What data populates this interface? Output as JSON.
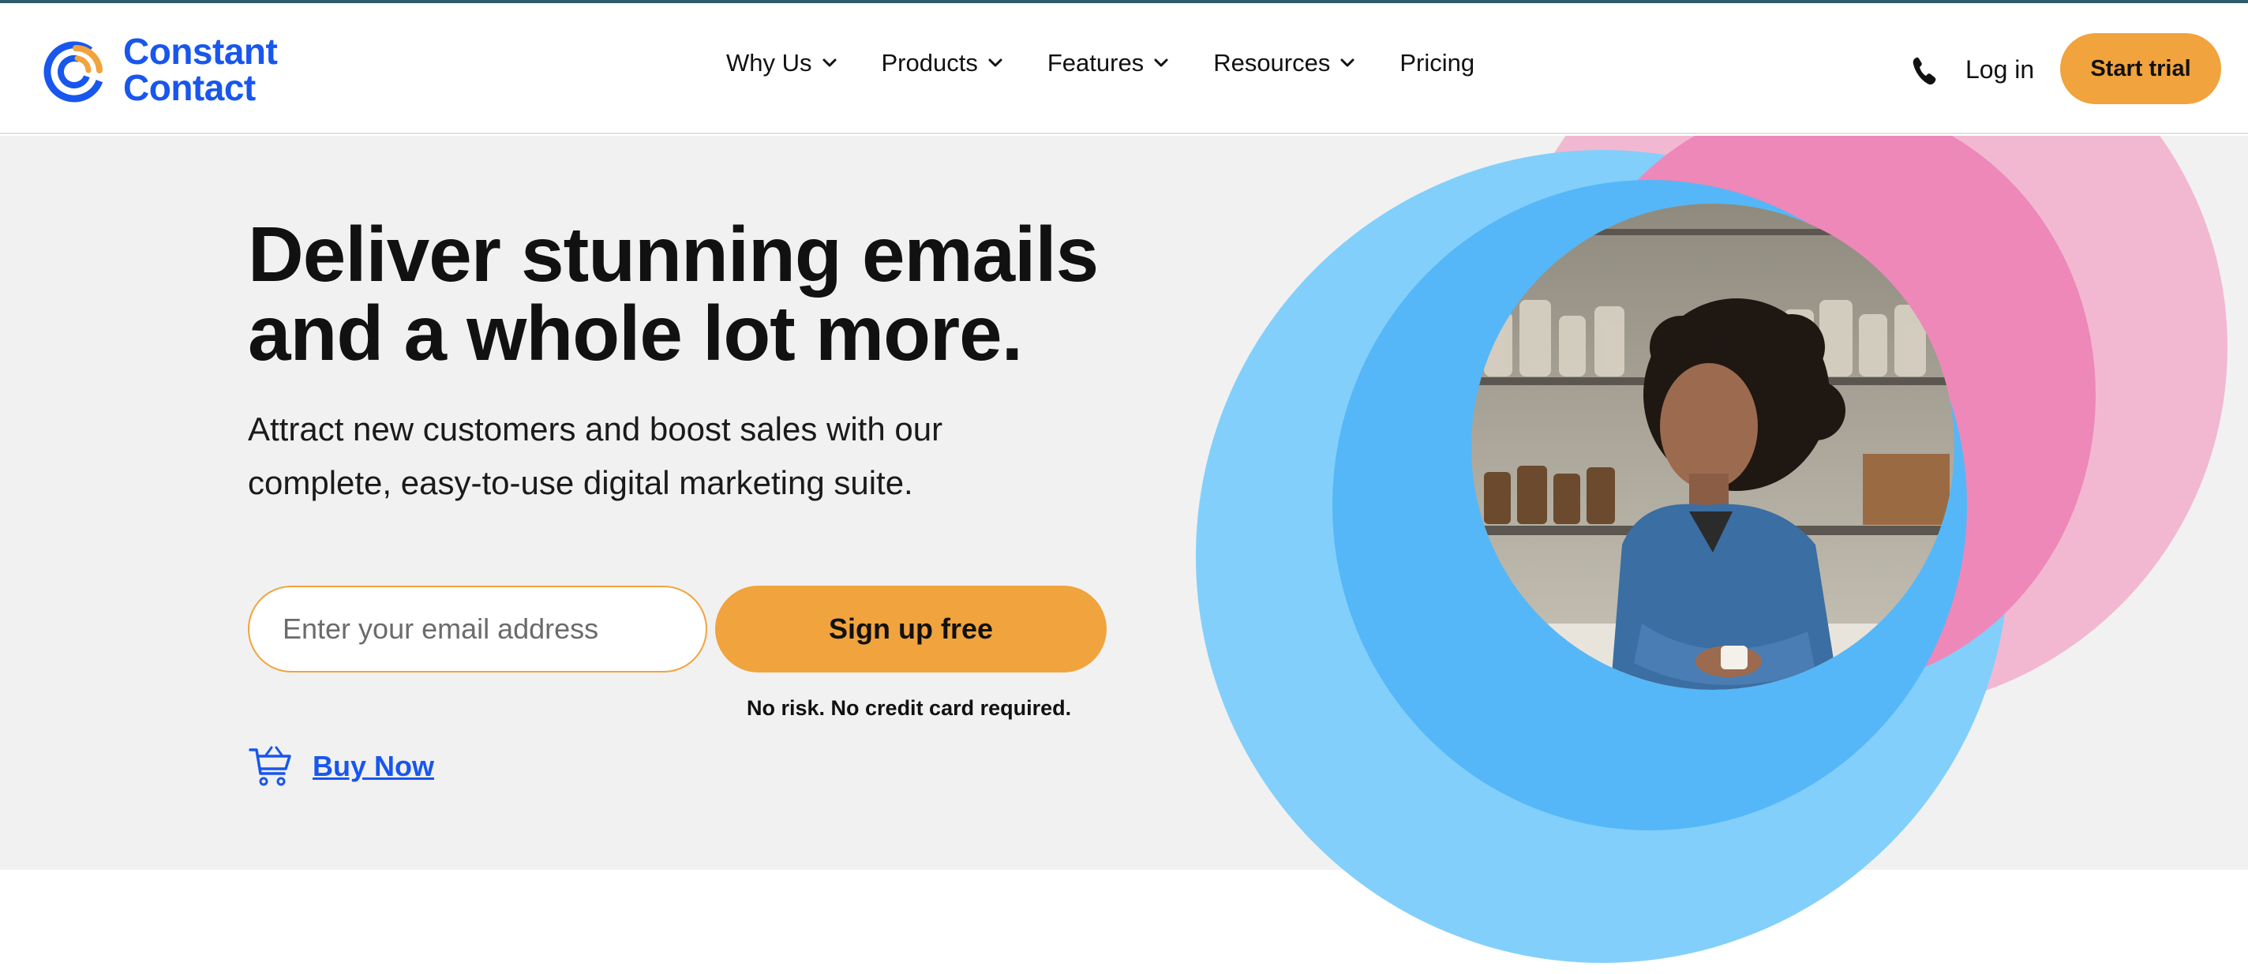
{
  "brand": {
    "name_line1": "Constant",
    "name_line2": "Contact",
    "color_primary": "#1856ed",
    "color_accent": "#f1a33d"
  },
  "nav": {
    "items": [
      {
        "label": "Why Us",
        "has_dropdown": true
      },
      {
        "label": "Products",
        "has_dropdown": true
      },
      {
        "label": "Features",
        "has_dropdown": true
      },
      {
        "label": "Resources",
        "has_dropdown": true
      },
      {
        "label": "Pricing",
        "has_dropdown": false
      }
    ],
    "phone_icon": "phone-icon",
    "login_label": "Log in",
    "start_trial_label": "Start trial"
  },
  "hero": {
    "headline_line1": "Deliver stunning emails",
    "headline_line2": "and a whole lot more.",
    "subhead_line1": "Attract new customers and boost sales with our",
    "subhead_line2": "complete, easy-to-use digital marketing suite.",
    "email_placeholder": "Enter your email address",
    "email_value": "",
    "signup_label": "Sign up free",
    "disclaimer": "No risk. No credit card required.",
    "buy_now_label": "Buy Now",
    "buy_icon": "cart-icon",
    "image_subject": "woman-in-denim-shirt-photo"
  },
  "colors": {
    "hero_bg": "#f1f1f1",
    "circle_light_blue": "#82cffb",
    "circle_blue": "#55b7f7",
    "circle_light_pink": "#f2b8d2",
    "circle_pink": "#ee88b9"
  }
}
